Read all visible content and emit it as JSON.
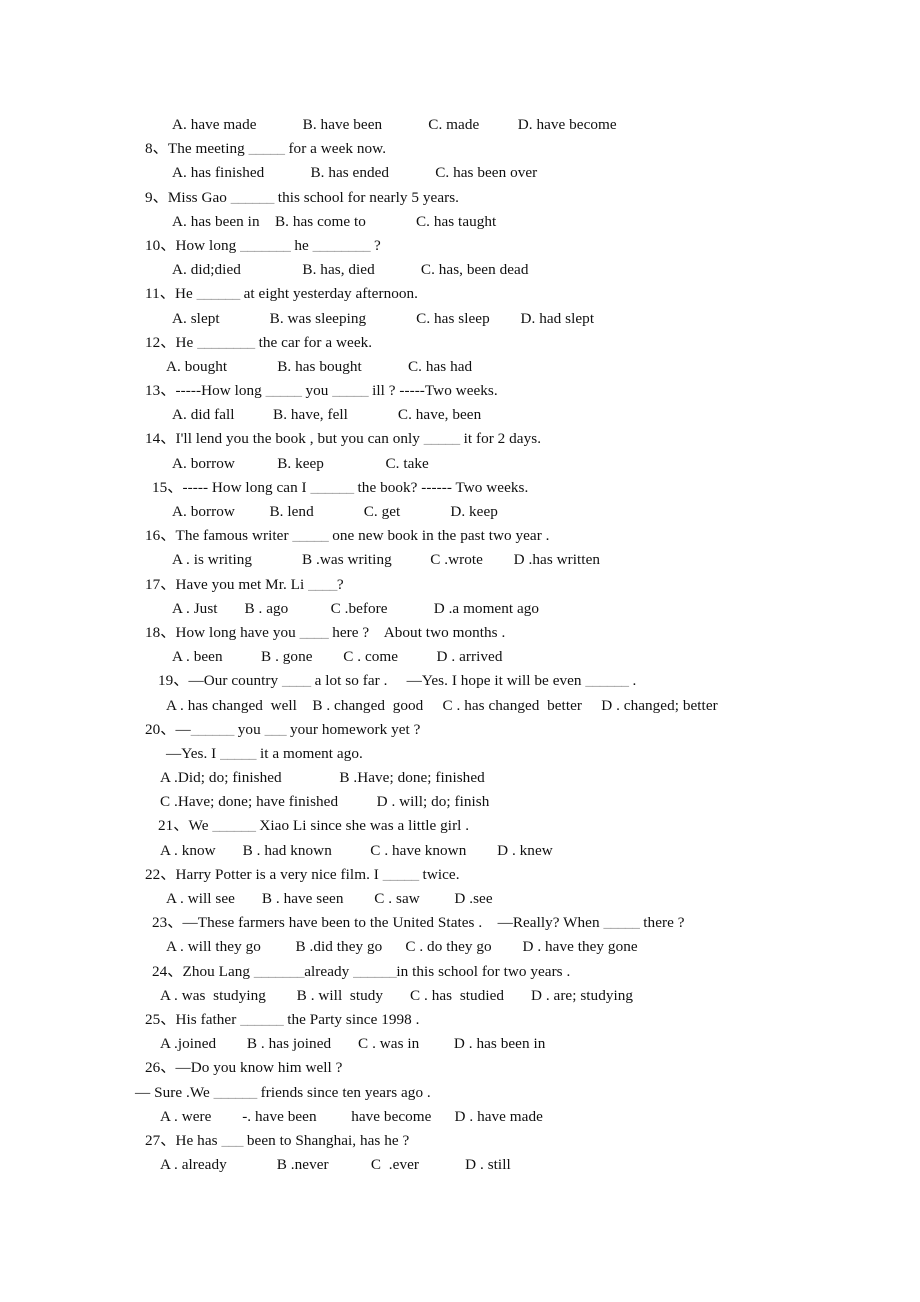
{
  "document": {
    "type": "english-grammar-worksheet",
    "background_color": "#ffffff",
    "text_color": "#101010",
    "enumeration_mark": "、",
    "blank_color": "#8d8d8d"
  },
  "lines": [
    {
      "id": "q7-options",
      "indent": "opt",
      "text": "A. have made            B. have been            C. made          D. have become"
    },
    {
      "id": "q8-stem",
      "indent": "q",
      "text": "8、The meeting _____ for a week now."
    },
    {
      "id": "q8-options",
      "indent": "opt",
      "text": "A. has finished            B. has ended            C. has been over"
    },
    {
      "id": "q9-stem",
      "indent": "q",
      "text": "9、Miss Gao ______ this school for nearly 5 years."
    },
    {
      "id": "q9-options",
      "indent": "opt",
      "text": "A. has been in    B. has come to             C. has taught"
    },
    {
      "id": "q10-stem",
      "indent": "q",
      "text": "10、How long _______ he ________ ?"
    },
    {
      "id": "q10-options",
      "indent": "opt",
      "text": "A. did;died                B. has, died            C. has, been dead"
    },
    {
      "id": "q11-stem",
      "indent": "q",
      "text": "11、He ______ at eight yesterday afternoon."
    },
    {
      "id": "q11-options",
      "indent": "opt",
      "text": "A. slept             B. was sleeping             C. has sleep        D. had slept"
    },
    {
      "id": "q12-stem",
      "indent": "q",
      "text": "12、He ________ the car for a week."
    },
    {
      "id": "q12-options",
      "indent": "opt-n",
      "text": "A. bought             B. has bought            C. has had"
    },
    {
      "id": "q13-stem",
      "indent": "q",
      "text": "13、-----How long _____ you _____ ill ? -----Two weeks."
    },
    {
      "id": "q13-options",
      "indent": "opt",
      "text": "A. did fall          B. have, fell             C. have, been"
    },
    {
      "id": "q14-stem",
      "indent": "q",
      "text": "14、I'll lend you the book , but you can only _____ it for 2 days."
    },
    {
      "id": "q14-options",
      "indent": "opt",
      "text": "A. borrow           B. keep                C. take"
    },
    {
      "id": "q15-stem",
      "indent": "q-in",
      "text": "15、----- How long can I ______ the book? ------ Two weeks."
    },
    {
      "id": "q15-options",
      "indent": "opt",
      "text": "A. borrow         B. lend             C. get             D. keep"
    },
    {
      "id": "q16-stem",
      "indent": "q",
      "text": "16、The famous writer _____ one new book in the past two year ."
    },
    {
      "id": "q16-options",
      "indent": "opt",
      "text": "A . is writing             B .was writing          C .wrote        D .has written"
    },
    {
      "id": "q17-stem",
      "indent": "q",
      "text": "17、Have you met Mr. Li ____?"
    },
    {
      "id": "q17-options",
      "indent": "opt",
      "text": "A . Just       B . ago           C .before            D .a moment ago"
    },
    {
      "id": "q18-stem",
      "indent": "q",
      "text": "18、How long have you ____ here ?    About two months ."
    },
    {
      "id": "q18-options",
      "indent": "opt",
      "text": "A . been          B . gone        C . come          D . arrived"
    },
    {
      "id": "q19-stem",
      "indent": "q-in2",
      "text": "19、—Our country ____ a lot so far .     —Yes. I hope it will be even ______ ."
    },
    {
      "id": "q19-options",
      "indent": "opt-n",
      "text": "A . has changed  well    B . changed  good     C . has changed  better     D . changed; better"
    },
    {
      "id": "q20-stem",
      "indent": "q",
      "text": "20、—______ you ___ your homework yet ?"
    },
    {
      "id": "q20-answer",
      "indent": "opt-n",
      "text": "—Yes. I _____ it a moment ago."
    },
    {
      "id": "q20-optsAB",
      "indent": "opt-w",
      "text": "A .Did; do; finished               B .Have; done; finished"
    },
    {
      "id": "q20-optsCD",
      "indent": "opt-w",
      "text": "C .Have; done; have finished          D . will; do; finish"
    },
    {
      "id": "q21-stem",
      "indent": "q-in2",
      "text": "21、We ______ Xiao Li since she was a little girl ."
    },
    {
      "id": "q21-options",
      "indent": "opt-w",
      "text": "A . know       B . had known          C . have known        D . knew"
    },
    {
      "id": "q22-stem",
      "indent": "q",
      "text": "22、Harry Potter is a very nice film. I _____ twice."
    },
    {
      "id": "q22-options",
      "indent": "opt-n",
      "text": "A . will see       B . have seen        C . saw         D .see"
    },
    {
      "id": "q23-stem",
      "indent": "q-in",
      "text": "23、—These farmers have been to the United States .    —Really? When _____ there ?"
    },
    {
      "id": "q23-options",
      "indent": "opt-n",
      "text": "A . will they go         B .did they go      C . do they go        D . have they gone"
    },
    {
      "id": "q24-stem",
      "indent": "q-in",
      "text": "24、Zhou Lang _______already ______in this school for two years ."
    },
    {
      "id": "q24-options",
      "indent": "opt-w",
      "text": "A . was  studying        B . will  study       C . has  studied       D . are; studying"
    },
    {
      "id": "q25-stem",
      "indent": "q",
      "text": "25、His father ______ the Party since 1998 ."
    },
    {
      "id": "q25-options",
      "indent": "opt-w",
      "text": "A .joined        B . has joined       C . was in         D . has been in"
    },
    {
      "id": "q26-stem",
      "indent": "q",
      "text": "26、—Do you know him well ?"
    },
    {
      "id": "q26-answer",
      "indent": "ans",
      "text": "— Sure .We ______ friends since ten years ago ."
    },
    {
      "id": "q26-options",
      "indent": "opt-w",
      "text": "A . were        -. have been         have become      D . have made"
    },
    {
      "id": "q27-stem",
      "indent": "q",
      "text": "27、He has ___ been to Shanghai, has he ?"
    },
    {
      "id": "q27-options",
      "indent": "opt-w",
      "text": "A . already             B .never           C  .ever            D . still"
    }
  ]
}
